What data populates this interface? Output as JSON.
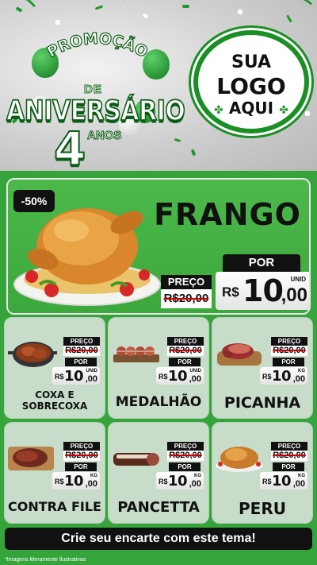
{
  "header": {
    "promo_line": "PROMOÇÃO",
    "de": "DE",
    "aniversario": "ANIVERSÁRIO",
    "number": "4",
    "anos": "ANOS",
    "logo": {
      "line1": "SUA",
      "line2": "LOGO",
      "line3": "AQUI"
    }
  },
  "featured": {
    "discount": "-50%",
    "name": "FRANGO",
    "preco_label": "PREÇO",
    "old_price": "R$20,00",
    "por_label": "POR",
    "currency": "R$",
    "price_int": "10",
    "price_cents": ",00",
    "unit": "UNID"
  },
  "products": [
    {
      "name": "COXA E SOBRECOXA",
      "preco_label": "PREÇO",
      "old_price": "R$20,00",
      "por_label": "POR",
      "currency": "R$",
      "price_int": "10",
      "price_cents": ",00",
      "unit": "UNID"
    },
    {
      "name": "MEDALHÃO",
      "preco_label": "PREÇO",
      "old_price": "R$20,00",
      "por_label": "POR",
      "currency": "R$",
      "price_int": "10",
      "price_cents": ",00",
      "unit": "UNID"
    },
    {
      "name": "PICANHA",
      "preco_label": "PREÇO",
      "old_price": "R$20,00",
      "por_label": "POR",
      "currency": "R$",
      "price_int": "10",
      "price_cents": ",00",
      "unit": "KG"
    },
    {
      "name": "CONTRA FILE",
      "preco_label": "PREÇO",
      "old_price": "R$20,00",
      "por_label": "POR",
      "currency": "R$",
      "price_int": "10",
      "price_cents": ",00",
      "unit": "KG"
    },
    {
      "name": "PANCETTA",
      "preco_label": "PREÇO",
      "old_price": "R$20,00",
      "por_label": "POR",
      "currency": "R$",
      "price_int": "10",
      "price_cents": ",00",
      "unit": "KG"
    },
    {
      "name": "PERU",
      "preco_label": "PREÇO",
      "old_price": "R$20,00",
      "por_label": "POR",
      "currency": "R$",
      "price_int": "10",
      "price_cents": ",00",
      "unit": "KG"
    }
  ],
  "cta": "Crie seu encarte com este tema!",
  "disclaimer": "*Imagens Meramente Ilustrativas",
  "colors": {
    "brand_green": "#35a53b",
    "dark_green": "#0b5d14",
    "card_bg": "#c7dcc9",
    "black": "#111111"
  }
}
